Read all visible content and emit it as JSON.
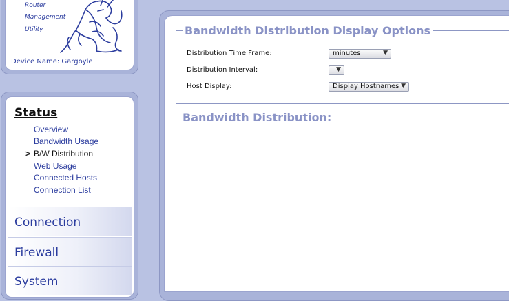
{
  "logo": {
    "line1": "Router",
    "line2": "Management",
    "line3": "Utility",
    "device_name": "Device Name: Gargoyle"
  },
  "nav": {
    "status_title": "Status",
    "status_items": [
      {
        "label": "Overview"
      },
      {
        "label": "Bandwidth Usage"
      },
      {
        "label": "B/W Distribution"
      },
      {
        "label": "Web Usage"
      },
      {
        "label": "Connected Hosts"
      },
      {
        "label": "Connection List"
      }
    ],
    "active_marker": ">",
    "sections": [
      {
        "label": "Connection"
      },
      {
        "label": "Firewall"
      },
      {
        "label": "System"
      }
    ]
  },
  "main": {
    "options_title": "Bandwidth Distribution Display Options",
    "fields": [
      {
        "label": "Distribution Time Frame:",
        "value": "minutes"
      },
      {
        "label": "Distribution Interval:",
        "value": ""
      },
      {
        "label": "Host Display:",
        "value": "Display Hostnames"
      }
    ],
    "dropdown_arrow": "▼",
    "distribution_heading": "Bandwidth Distribution:"
  }
}
